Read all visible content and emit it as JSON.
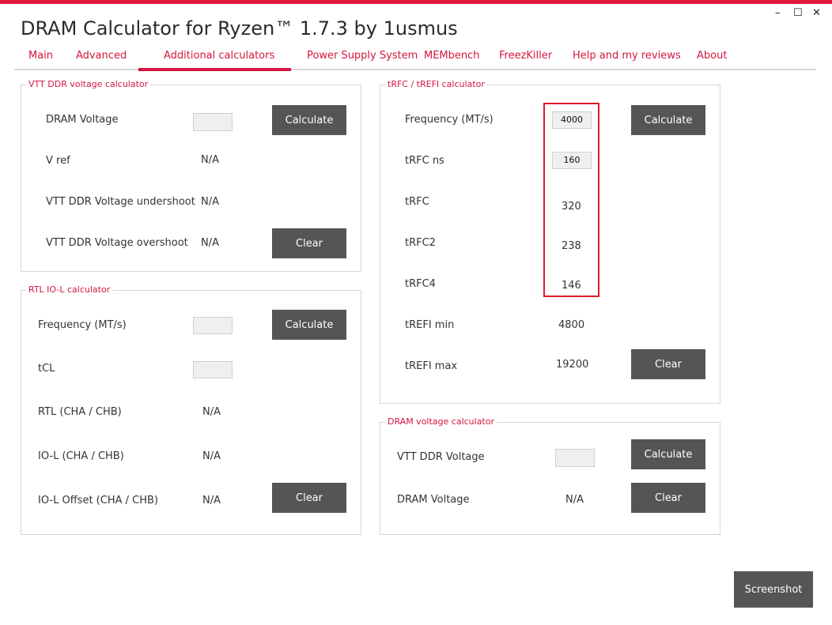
{
  "window": {
    "title": "DRAM Calculator for Ryzen™ 1.7.3 by 1usmus",
    "controls": {
      "minimize": "–",
      "maximize": "☐",
      "close": "✕"
    }
  },
  "tabs": [
    {
      "label": "Main"
    },
    {
      "label": "Advanced"
    },
    {
      "label": "Additional calculators",
      "active": true
    },
    {
      "label": "Power Supply System"
    },
    {
      "label": "MEMbench"
    },
    {
      "label": "FreezKiller"
    },
    {
      "label": "Help and my reviews"
    },
    {
      "label": "About"
    }
  ],
  "vtt": {
    "title": "VTT DDR voltage calculator",
    "dram_voltage_label": "DRAM Voltage",
    "dram_voltage_value": "",
    "vref_label": "V ref",
    "vref_value": "N/A",
    "undershoot_label": "VTT DDR Voltage undershoot",
    "undershoot_value": "N/A",
    "overshoot_label": "VTT DDR Voltage overshoot",
    "overshoot_value": "N/A",
    "calculate": "Calculate",
    "clear": "Clear"
  },
  "rtl": {
    "title": "RTL IO-L calculator",
    "freq_label": "Frequency (MT/s)",
    "freq_value": "",
    "tcl_label": "tCL",
    "tcl_value": "",
    "rtl_label": "RTL (CHA / CHB)",
    "rtl_value": "N/A",
    "iol_label": "IO-L (CHA / CHB)",
    "iol_value": "N/A",
    "iol_offset_label": "IO-L Offset (CHA / CHB)",
    "iol_offset_value": "N/A",
    "calculate": "Calculate",
    "clear": "Clear"
  },
  "trfc": {
    "title": "tRFC / tREFI calculator",
    "freq_label": "Frequency (MT/s)",
    "freq_value": "4000",
    "trfc_ns_label": "tRFC ns",
    "trfc_ns_value": "160",
    "trfc_label": "tRFC",
    "trfc_value": "320",
    "trfc2_label": "tRFC2",
    "trfc2_value": "238",
    "trfc4_label": "tRFC4",
    "trfc4_value": "146",
    "trefi_min_label": "tREFI min",
    "trefi_min_value": "4800",
    "trefi_max_label": "tREFI max",
    "trefi_max_value": "19200",
    "calculate": "Calculate",
    "clear": "Clear"
  },
  "dramv": {
    "title": "DRAM voltage calculator",
    "vtt_label": "VTT DDR Voltage",
    "vtt_value": "",
    "dram_label": "DRAM Voltage",
    "dram_value": "N/A",
    "calculate": "Calculate",
    "clear": "Clear"
  },
  "screenshot_button": "Screenshot",
  "colors": {
    "accent": "#d41640",
    "button": "#555555",
    "highlight": "#e01a2e"
  }
}
